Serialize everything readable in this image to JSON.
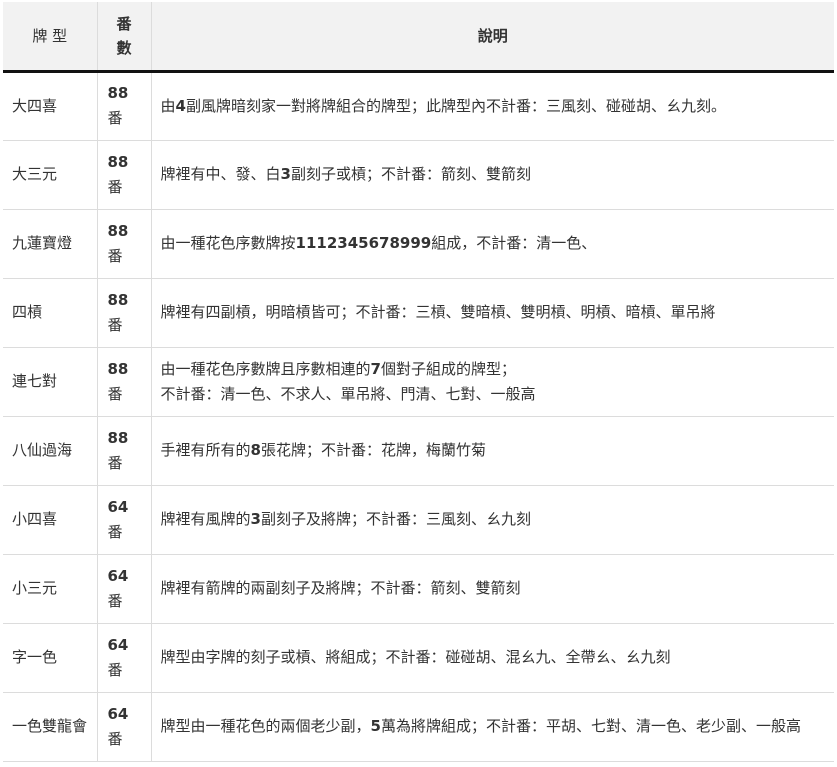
{
  "header": {
    "name": "牌 型",
    "fan": "番數",
    "desc": "說明"
  },
  "rows": [
    {
      "name": "大四喜",
      "fan": "88",
      "unit": "番",
      "desc": [
        {
          "t": "由",
          "b": false
        },
        {
          "t": "4",
          "b": true
        },
        {
          "t": "副風牌暗刻家一對將牌組合的牌型；此牌型內不計番：三風刻、碰碰胡、ㄠ九刻。",
          "b": false
        }
      ]
    },
    {
      "name": "大三元",
      "fan": "88",
      "unit": "番",
      "desc": [
        {
          "t": "牌裡有中、發、白",
          "b": false
        },
        {
          "t": "3",
          "b": true
        },
        {
          "t": "副刻子或槓；不計番：箭刻、雙箭刻",
          "b": false
        }
      ]
    },
    {
      "name": "九蓮寶燈",
      "fan": "88",
      "unit": "番",
      "desc": [
        {
          "t": "由一種花色序數牌按",
          "b": false
        },
        {
          "t": "1112345678999",
          "b": true
        },
        {
          "t": "組成，不計番：清一色、",
          "b": false
        }
      ]
    },
    {
      "name": "四槓",
      "fan": "88",
      "unit": "番",
      "desc": [
        {
          "t": "牌裡有四副槓，明暗槓皆可；不計番：三槓、雙暗槓、雙明槓、明槓、暗槓、單吊將",
          "b": false
        }
      ]
    },
    {
      "name": "連七對",
      "fan": "88",
      "unit": "番",
      "desc": [
        {
          "t": "由一種花色序數牌且序數相連的",
          "b": false
        },
        {
          "t": "7",
          "b": true
        },
        {
          "t": "個對子組成的牌型；",
          "b": false
        },
        {
          "br": true
        },
        {
          "t": "不計番：清一色、不求人、單吊將、門清、七對、一般高",
          "b": false
        }
      ]
    },
    {
      "name": "八仙過海",
      "fan": "88",
      "unit": "番",
      "desc": [
        {
          "t": "手裡有所有的",
          "b": false
        },
        {
          "t": "8",
          "b": true
        },
        {
          "t": "張花牌；不計番：花牌，梅蘭竹菊",
          "b": false
        }
      ]
    },
    {
      "name": "小四喜",
      "fan": "64",
      "unit": "番",
      "desc": [
        {
          "t": "牌裡有風牌的",
          "b": false
        },
        {
          "t": "3",
          "b": true
        },
        {
          "t": "副刻子及將牌；不計番：三風刻、ㄠ九刻",
          "b": false
        }
      ]
    },
    {
      "name": "小三元",
      "fan": "64",
      "unit": "番",
      "desc": [
        {
          "t": "牌裡有箭牌的兩副刻子及將牌；不計番：箭刻、雙箭刻",
          "b": false
        }
      ]
    },
    {
      "name": "字一色",
      "fan": "64",
      "unit": "番",
      "desc": [
        {
          "t": "牌型由字牌的刻子或槓、將組成；不計番：碰碰胡、混ㄠ九、全帶ㄠ、ㄠ九刻",
          "b": false
        }
      ]
    },
    {
      "name": "一色雙龍會",
      "fan": "64",
      "unit": "番",
      "desc": [
        {
          "t": "牌型由一種花色的兩個老少副，",
          "b": false
        },
        {
          "t": "5",
          "b": true
        },
        {
          "t": "萬為將牌組成；不計番：平胡、七對、清一色、老少副、一般高",
          "b": false
        }
      ]
    }
  ]
}
